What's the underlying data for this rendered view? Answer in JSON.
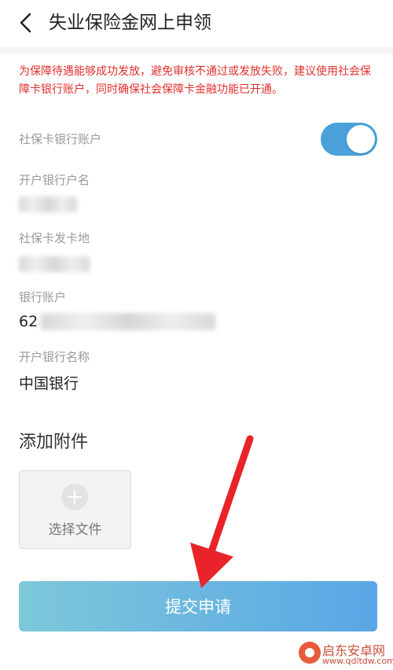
{
  "header": {
    "title": "失业保险金网上申领"
  },
  "notice": "为保障待遇能够成功发放，避免审核不通过或发放失败，建议使用社会保障卡银行账户，同时确保社会保障卡金融功能已开通。",
  "fields": {
    "social_card_account_label": "社保卡银行账户",
    "toggle_on": true,
    "account_name_label": "开户银行户名",
    "card_issue_place_label": "社保卡发卡地",
    "bank_account_label": "银行账户",
    "bank_account_prefix": "62",
    "bank_name_label": "开户银行名称",
    "bank_name_value": "中国银行"
  },
  "attachments": {
    "section_title": "添加附件",
    "select_file_label": "选择文件"
  },
  "submit_label": "提交申请",
  "watermark": {
    "text": "启东安卓网",
    "sub": "www.qdltdw.com"
  },
  "colors": {
    "accent": "#4aa0d9",
    "notice": "#e0302d",
    "arrow": "#e8232a"
  }
}
